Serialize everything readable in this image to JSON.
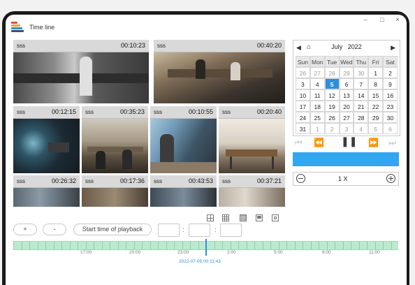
{
  "window": {
    "title": "Time line",
    "controls": [
      "–",
      "□",
      "×"
    ]
  },
  "cameras": [
    {
      "name": "sss",
      "time": "00:10:23"
    },
    {
      "name": "sss",
      "time": "00:40:20"
    },
    {
      "name": "sss",
      "time": "00:12:15"
    },
    {
      "name": "sss",
      "time": "00:35:23"
    },
    {
      "name": "sss",
      "time": "00:10:55"
    },
    {
      "name": "sss",
      "time": "00:20:40"
    },
    {
      "name": "sss",
      "time": "00:26:32"
    },
    {
      "name": "sss",
      "time": "00:17:36"
    },
    {
      "name": "sss",
      "time": "00:43:53"
    },
    {
      "name": "sss",
      "time": "00:37:21"
    }
  ],
  "calendar": {
    "month": "July",
    "year": "2022",
    "weekdays": [
      "Sun",
      "Mon",
      "Tue",
      "Wed",
      "Thu",
      "Fri",
      "Sat"
    ],
    "weeks": [
      [
        "26",
        "27",
        "28",
        "29",
        "30",
        "1",
        "2"
      ],
      [
        "3",
        "4",
        "5",
        "6",
        "7",
        "8",
        "9"
      ],
      [
        "10",
        "11",
        "12",
        "13",
        "14",
        "15",
        "16"
      ],
      [
        "17",
        "18",
        "19",
        "20",
        "21",
        "22",
        "23"
      ],
      [
        "24",
        "25",
        "26",
        "27",
        "28",
        "29",
        "30"
      ],
      [
        "31",
        "1",
        "2",
        "3",
        "4",
        "5",
        "6"
      ]
    ],
    "selected_day": "5"
  },
  "playback": {
    "speed": "1 X",
    "accent": "#32a6ee"
  },
  "controls": {
    "zoom_in": "+",
    "zoom_out": "-",
    "start_time_label": "Start time of playback",
    "time_separator": ":"
  },
  "timeline": {
    "labels": [
      "17:00",
      "20:00",
      "23:00",
      "2:00",
      "5:00",
      "8:00",
      "11:00"
    ],
    "current": "2022-07-05 00:11:43",
    "color": "#bfe9cf"
  }
}
